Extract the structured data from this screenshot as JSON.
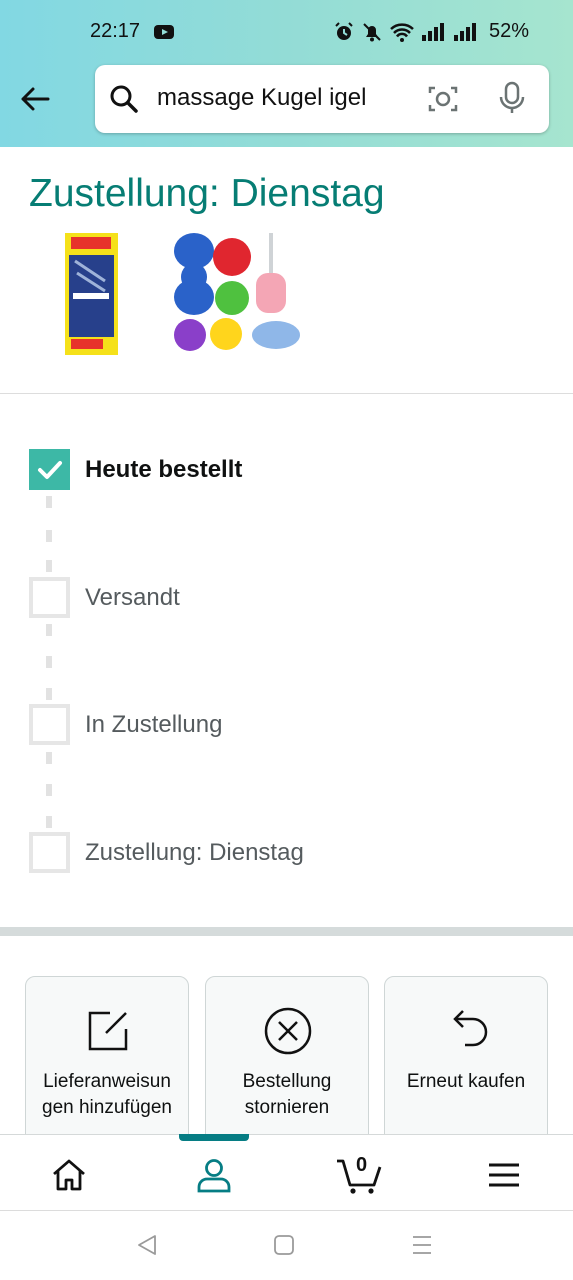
{
  "status_bar": {
    "time": "22:17",
    "battery": "52%"
  },
  "search": {
    "query": "massage Kugel igel"
  },
  "delivery": {
    "heading": "Zustellung: Dienstag"
  },
  "progress": {
    "steps": [
      {
        "label": "Heute bestellt",
        "done": true
      },
      {
        "label": "Versandt",
        "done": false
      },
      {
        "label": "In Zustellung",
        "done": false
      },
      {
        "label": "Zustellung: Dienstag",
        "done": false
      }
    ]
  },
  "actions": {
    "delivery_instructions": "Lieferanweisun gen hinzufügen",
    "delivery_instructions_line1": "Lieferanweisun",
    "delivery_instructions_line2": "gen hinzufügen",
    "cancel_line1": "Bestellung",
    "cancel_line2": "stornieren",
    "buy_again": "Erneut kaufen"
  },
  "bottom_nav": {
    "cart_count": "0",
    "active": "account"
  },
  "colors": {
    "accent": "#067d74",
    "check": "#3db8a6"
  }
}
